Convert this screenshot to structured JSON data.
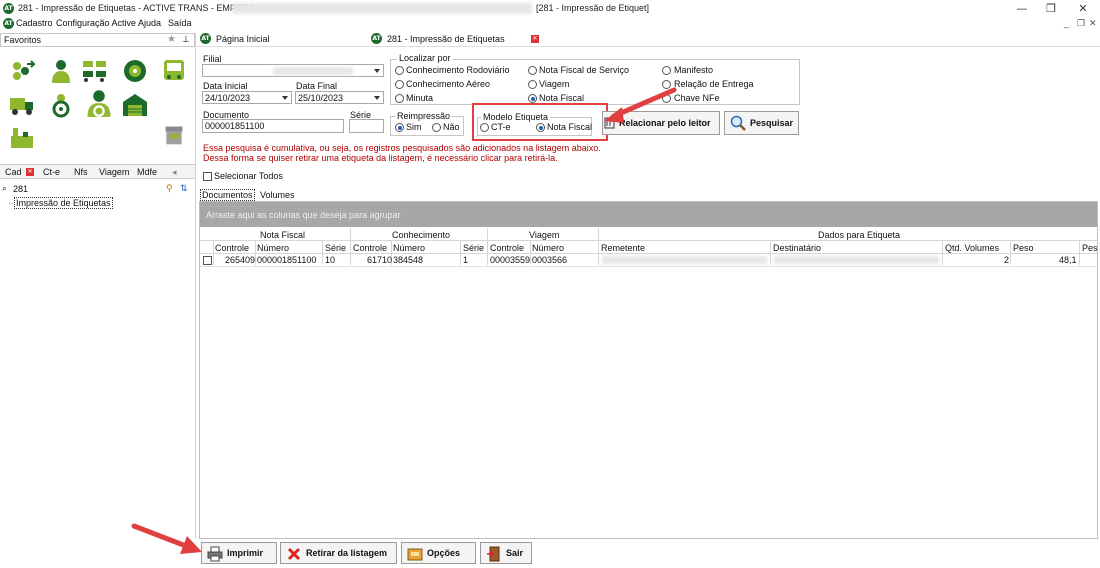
{
  "window": {
    "title": "281 - Impressão de Etiquetas - ACTIVE TRANS - EMPRESA:",
    "title_right": "[281 - Impressão de Etiquet]",
    "icon_text": "AT",
    "minimize": "—",
    "restore": "❐",
    "close": "✕"
  },
  "menu": {
    "items": [
      "Cadastro",
      "Configuração Active",
      "Ajuda",
      "Saída"
    ]
  },
  "mdi_controls": {
    "minimize": "_",
    "restore": "❐",
    "close": "✕"
  },
  "left": {
    "favorites_label": "Favoritos",
    "tabs": [
      "Cad",
      "Ct-e",
      "Nfs",
      "Viagem",
      "Mdfe"
    ],
    "search_value": "281",
    "tree_item": "Impressão de Etiquetas"
  },
  "doc_tabs": [
    "Página Inicial",
    "281 - Impressão de Etiquetas"
  ],
  "form": {
    "filial_label": "Filial",
    "data_inicial_label": "Data Inicial",
    "data_inicial_value": "24/10/2023",
    "data_final_label": "Data Final",
    "data_final_value": "25/10/2023",
    "documento_label": "Documento",
    "documento_value": "000001851100",
    "serie_label": "Série",
    "localizar_label": "Localizar por",
    "localizar_options": [
      "Conhecimento Rodoviário",
      "Nota Fiscal de Serviço",
      "Manifesto",
      "Conhecimento Aéreo",
      "Viagem",
      "Relação de Entrega",
      "Minuta",
      "Nota Fiscal",
      "Chave NFe"
    ],
    "localizar_selected": "Nota Fiscal",
    "reimpressao_label": "Reimpressão",
    "reimpressao_options": [
      "Sim",
      "Não"
    ],
    "reimpressao_selected": "Sim",
    "modelo_label": "Modelo Etiqueta",
    "modelo_options": [
      "CT-e",
      "Nota Fiscal"
    ],
    "modelo_selected": "Nota Fiscal",
    "relacionar_button": "Relacionar pelo leitor",
    "pesquisar_button": "Pesquisar",
    "warning_line1": "Essa pesquisa é cumulativa, ou seja, os registros pesquisados são adicionados na listagem abaixo.",
    "warning_line2": "Dessa forma se quiser retirar uma etiqueta da listagem, é necessário clicar para retirá-la.",
    "selecionar_todos": "Selecionar Todos"
  },
  "subtabs": [
    "Documentos",
    "Volumes"
  ],
  "grid": {
    "group_hint": "Arraste aqui as colunas que deseja para agrupar",
    "bands": [
      "Nota Fiscal",
      "Conhecimento",
      "Viagem",
      "Dados para Etiqueta"
    ],
    "columns": [
      "Controle",
      "Número",
      "Série",
      "Controle",
      "Número",
      "Série",
      "Controle",
      "Número",
      "Remetente",
      "Destinatário",
      "Qtd. Volumes",
      "Peso",
      "Pes"
    ],
    "rows": [
      {
        "nf_controle": "265409",
        "nf_numero": "000001851100",
        "nf_serie": "10",
        "ct_controle": "61710",
        "ct_numero": "384548",
        "ct_serie": "1",
        "vg_controle": "00003559",
        "vg_numero": "0003566",
        "qtd_volumes": "2",
        "peso": "48,1"
      }
    ]
  },
  "footer": {
    "imprimir": "Imprimir",
    "retirar": "Retirar da listagem",
    "opcoes": "Opções",
    "sair": "Sair"
  },
  "colors": {
    "annotation_red": "#e04040",
    "warning_text": "#b00000",
    "group_bar": "#a7a7a7",
    "app_green": "#1d6b2c"
  }
}
